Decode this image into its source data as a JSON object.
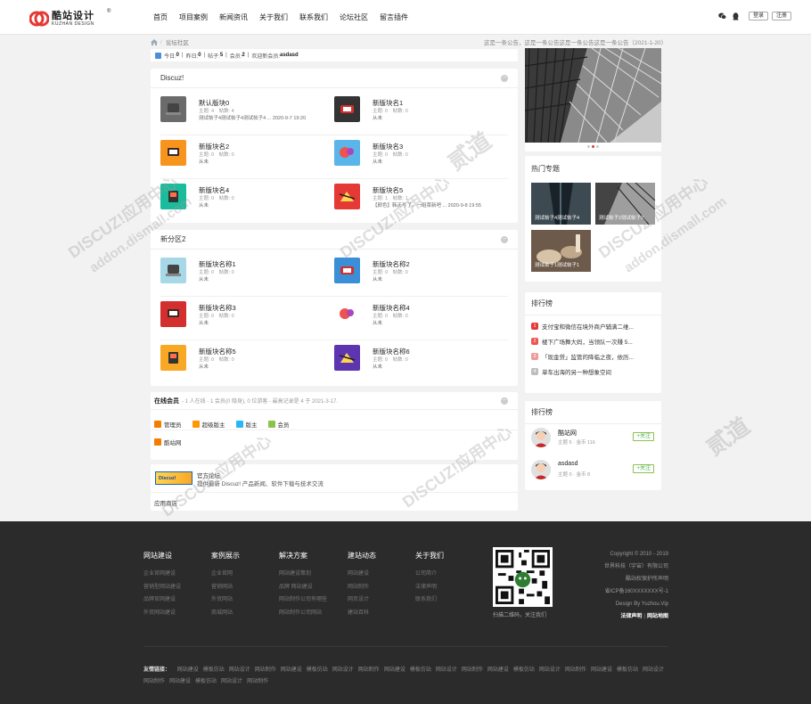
{
  "header": {
    "logo_cn": "酷站设计",
    "logo_en": "KUZHAN DESIGN",
    "logo_reg": "®",
    "nav": [
      "首页",
      "项目案例",
      "新闻资讯",
      "关于我们",
      "联系我们",
      "论坛社区",
      "留言插件"
    ],
    "login": "登录",
    "register": "注册"
  },
  "breadcrumb": {
    "label": "论坛社区"
  },
  "notice": "这是一条公告，这是一条公告这是一条公告这是一条公告（2021-1-20）",
  "stats": {
    "today_label": "今日:",
    "today": "0",
    "yesterday_label": "昨日:",
    "yesterday": "0",
    "posts_label": "帖子:",
    "posts": "5",
    "members_label": "会员:",
    "members": "2",
    "welcome_label": "欢迎新会员:",
    "newest": "asdasd"
  },
  "section1": {
    "title": "Discuz!",
    "forums": [
      {
        "name": "默认版块0",
        "stat": "主题: 4　帖数: 4",
        "last": "测试帖子4测试帖子4测试帖子4 ... 2020-9-7 19:20",
        "color": "#6b6b6b"
      },
      {
        "name": "新版块名1",
        "stat": "主题: 0　帖数: 0",
        "last": "从未",
        "color": "#333333"
      },
      {
        "name": "新版块名2",
        "stat": "主题: 0　帖数: 0",
        "last": "从未",
        "color": "#f7941d"
      },
      {
        "name": "新版块名3",
        "stat": "主题: 0　帖数: 0",
        "last": "从未",
        "color": "#5ab6e8"
      },
      {
        "name": "新版块名4",
        "stat": "主题: 0　帖数: 0",
        "last": "从未",
        "color": "#1abc9c"
      },
      {
        "name": "新版块名5",
        "stat": "主题: 1　帖数: 1",
        "last": "【颜色】韩天写了，一组菜新吧 ... 2020-9-8 19:55",
        "color": "#e53935"
      }
    ]
  },
  "section2": {
    "title": "新分区2",
    "forums": [
      {
        "name": "新版块名称1",
        "stat": "主题: 0　帖数: 0",
        "last": "从未",
        "color": "#a7d8e8"
      },
      {
        "name": "新版块名称2",
        "stat": "主题: 0　帖数: 0",
        "last": "从未",
        "color": "#3b8fd6"
      },
      {
        "name": "新版块名称3",
        "stat": "主题: 0　帖数: 0",
        "last": "从未",
        "color": "#d32f2f"
      },
      {
        "name": "新版块名称4",
        "stat": "主题: 0　帖数: 0",
        "last": "从未",
        "color": "#ffffff"
      },
      {
        "name": "新版块名称5",
        "stat": "主题: 0　帖数: 0",
        "last": "从未",
        "color": "#f9a825"
      },
      {
        "name": "新版块名称6",
        "stat": "主题: 0　帖数: 0",
        "last": "从未",
        "color": "#5e35b1"
      }
    ]
  },
  "online": {
    "title": "在线会员",
    "summary": "- 1 人在线 - 1 会员(0 隐身), 0 位游客 - 最高记录是 4 于 2021-3-17.",
    "legend": [
      {
        "label": "管理员",
        "color": "#f57c00"
      },
      {
        "label": "超级版主",
        "color": "#ff9800"
      },
      {
        "label": "版主",
        "color": "#29b6f6"
      },
      {
        "label": "会员",
        "color": "#8bc34a"
      }
    ],
    "member": "酷站网"
  },
  "official": {
    "banner_text": "Discuz!",
    "title": "官方论坛",
    "desc": "提供最新 Discuz! 产品新闻、软件下载与技术交流"
  },
  "apps_label": "应用商店",
  "hot": {
    "title": "热门专题",
    "topics": [
      "测试帖子4测试帖子4",
      "测试帖子2测试帖子2",
      "测试帖子1测试帖子1"
    ]
  },
  "ranking": {
    "title": "排行榜",
    "items": [
      {
        "num": "1",
        "text": "支付宝和微信在境外商户辅满二维...",
        "color": "#e53935"
      },
      {
        "num": "2",
        "text": "楼下广场舞大妈，当领队一次赚 5...",
        "color": "#ef5350"
      },
      {
        "num": "3",
        "text": "「现金贷」监管的降临之夜，依历...",
        "color": "#ef9a9a"
      },
      {
        "num": "4",
        "text": "单车出海的另一种想象空间",
        "color": "#bdbdbd"
      }
    ]
  },
  "users": {
    "title": "排行榜",
    "list": [
      {
        "name": "酷站网",
        "meta": "主题 5 · 金币 116",
        "follow": "+关注"
      },
      {
        "name": "asdasd",
        "meta": "主题 0 · 金币 8",
        "follow": "+关注"
      }
    ]
  },
  "footer": {
    "cols": [
      {
        "title": "网站建设",
        "links": [
          "企业官网建设",
          "营销型网站建设",
          "品牌官网建设",
          "外贸网站建设"
        ]
      },
      {
        "title": "案例展示",
        "links": [
          "企业官网",
          "营销网站",
          "外贸网站",
          "商城网站"
        ]
      },
      {
        "title": "解决方案",
        "links": [
          "网站建设策划",
          "品牌 网站建设",
          "网站制作公司有哪些",
          "网站制作公司网站"
        ]
      },
      {
        "title": "建站动态",
        "links": [
          "网站建设",
          "网站制作",
          "网页设计",
          "建站百科"
        ]
      },
      {
        "title": "关于我们",
        "links": [
          "公司简介",
          "法律声明",
          "联系我们"
        ]
      }
    ],
    "qr_caption": "扫描二维码，关注我们",
    "copyright": [
      "Copyright © 2010 - 2019",
      "世界科技（宇宙）有限公司",
      "酷站权保护所声明",
      "省ICP备160XXXXXXX号-1",
      "Design By Yuzhou.Vip"
    ],
    "legal": "法律声明",
    "sitemap": "网站地图",
    "friend_label": "友情链接：",
    "friends": [
      "网站建设",
      "模板仿站",
      "网站设计",
      "网站制作",
      "网站建设",
      "模板仿站",
      "网站设计",
      "网站制作",
      "网站建设",
      "模板仿站",
      "网站设计",
      "网站制作",
      "网站建设",
      "模板仿站",
      "网站设计",
      "网站制作",
      "网站建设",
      "模板仿站",
      "网站设计",
      "网站制作",
      "网站建设",
      "模板仿站",
      "网站设计",
      "网站制作"
    ]
  },
  "watermark": [
    "DISCUZ!应用中心",
    "addon.dismall.com",
    "贰道"
  ]
}
